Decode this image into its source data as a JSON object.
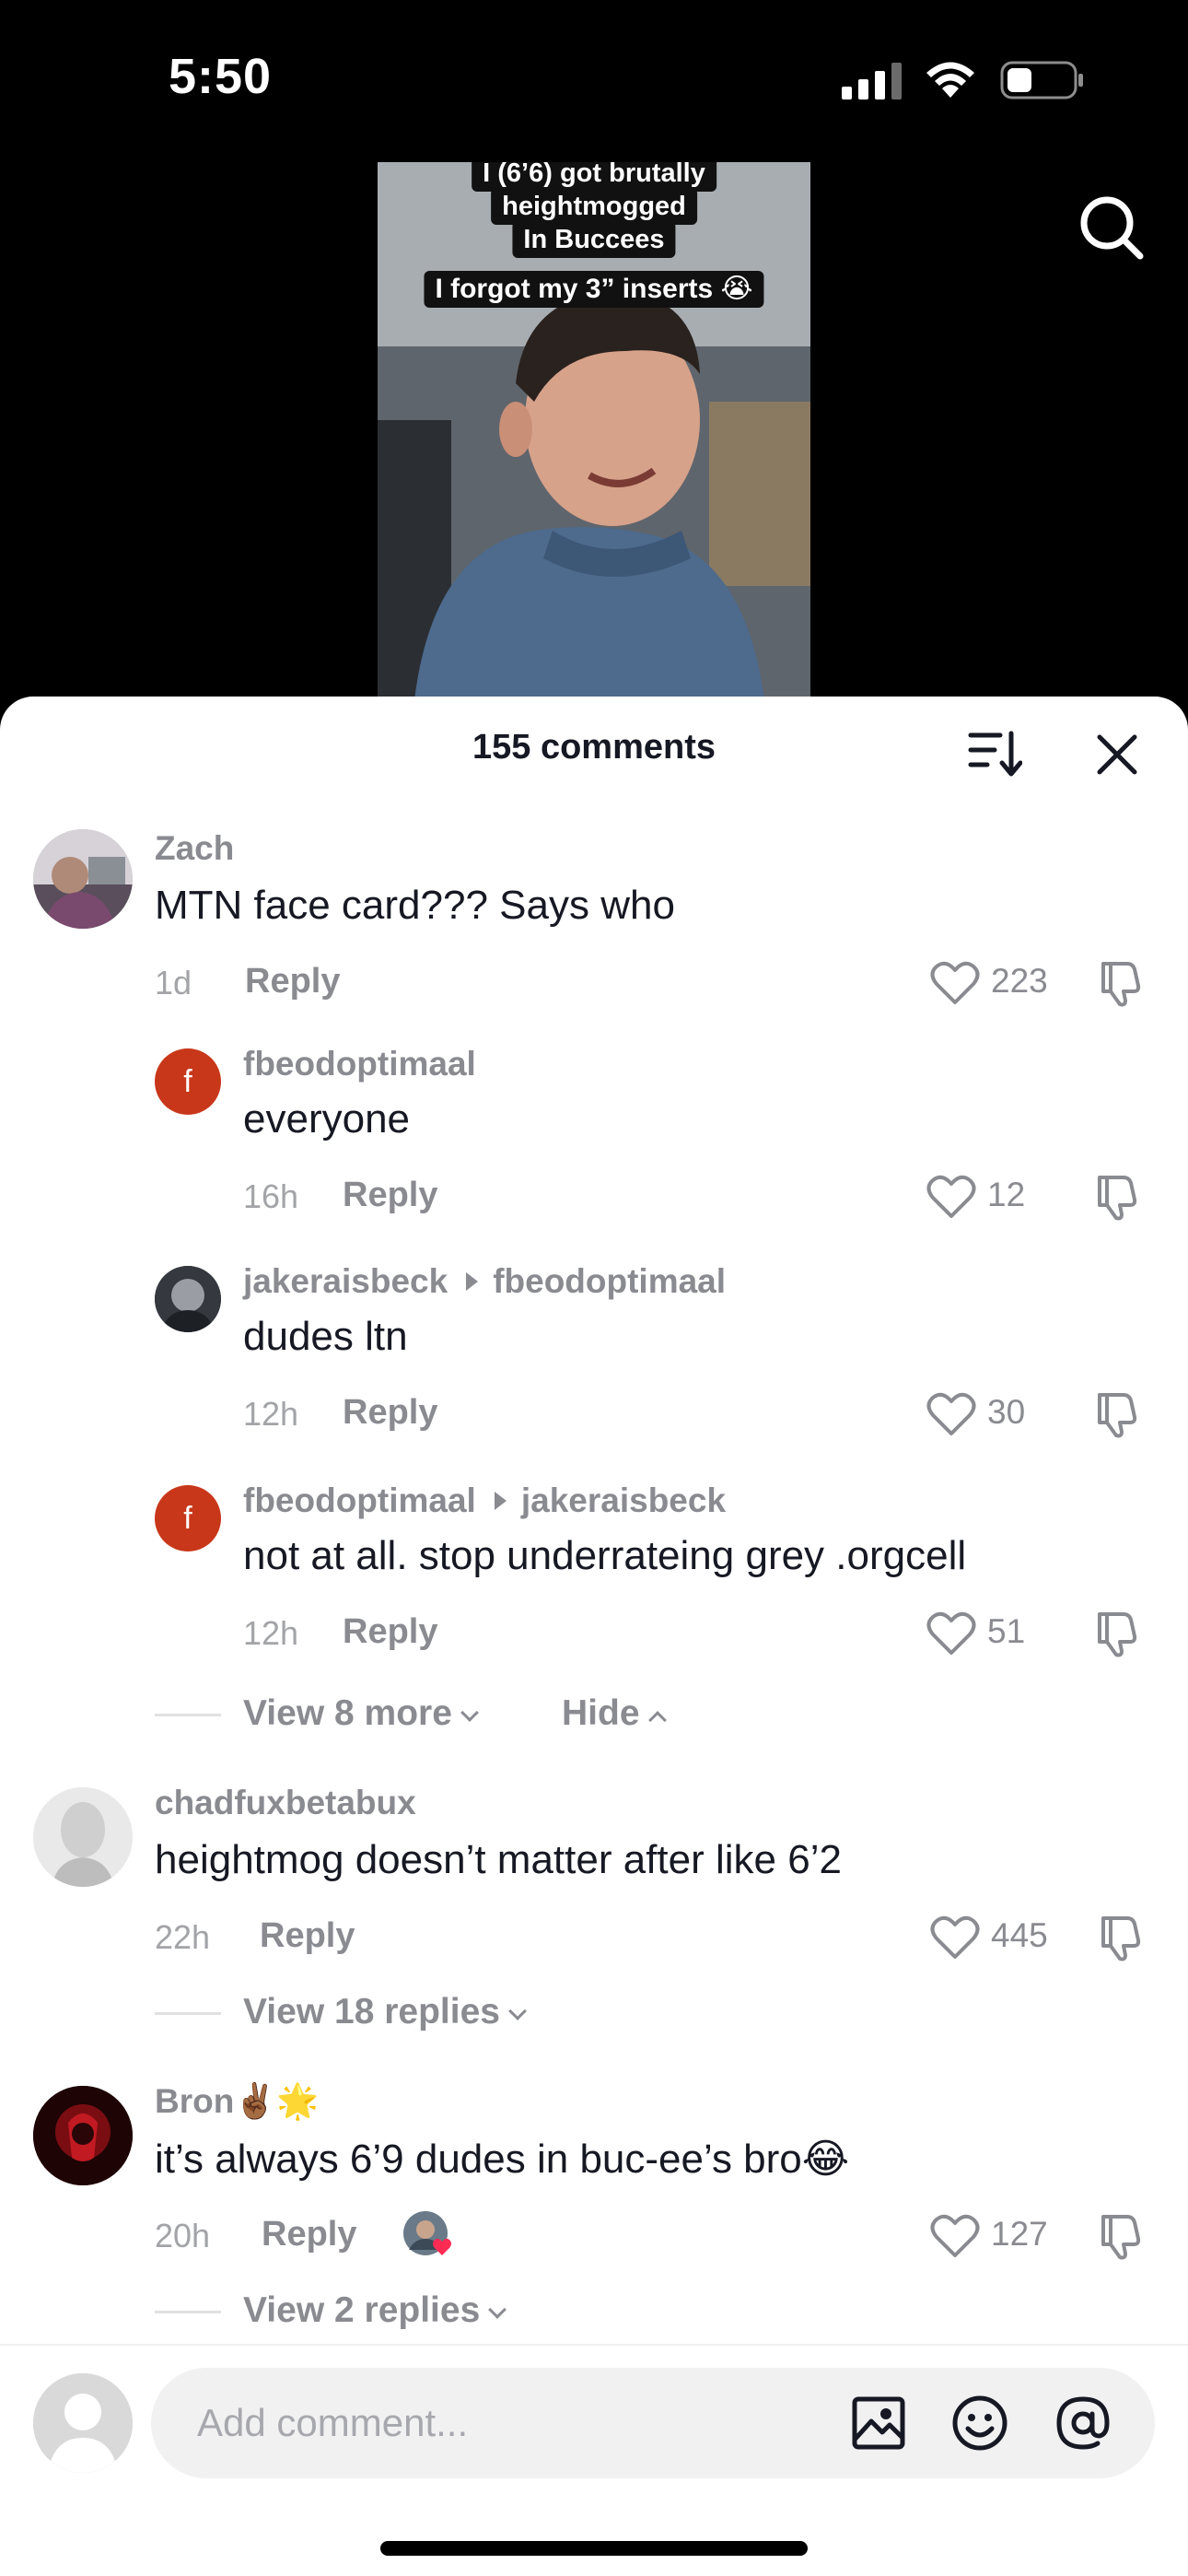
{
  "status_bar": {
    "time": "5:50"
  },
  "video": {
    "caption_lines": [
      "I (6’6) got brutally",
      "heightmogged",
      "In Buccees"
    ],
    "caption_2": "I forgot my 3” inserts 😭"
  },
  "sheet": {
    "title": "155 comments",
    "comments": [
      {
        "user": "Zach",
        "text": "MTN face card??? Says who",
        "time": "1d",
        "reply": "Reply",
        "likes": "223"
      },
      {
        "user": "fbeodoptimaal",
        "avatar_letter": "f",
        "text": "everyone",
        "time": "16h",
        "reply": "Reply",
        "likes": "12"
      },
      {
        "user": "jakeraisbeck",
        "reply_to": "fbeodoptimaal",
        "text": "dudes ltn",
        "time": "12h",
        "reply": "Reply",
        "likes": "30"
      },
      {
        "user": "fbeodoptimaal",
        "avatar_letter": "f",
        "reply_to": "jakeraisbeck",
        "text": "not at all. stop underrateing grey .orgcell",
        "time": "12h",
        "reply": "Reply",
        "likes": "51"
      },
      {
        "user": "chadfuxbetabux",
        "text": "heightmog doesn’t matter after like 6’2",
        "time": "22h",
        "reply": "Reply",
        "likes": "445"
      },
      {
        "user": "Bron✌🏾🌟",
        "text": "it’s always 6’9 dudes in buc-ee’s bro😂",
        "time": "20h",
        "reply": "Reply",
        "likes": "127"
      }
    ],
    "view_more_1": "View 8 more",
    "hide": "Hide",
    "view_replies_2": "View 18 replies",
    "view_replies_3": "View 2 replies"
  },
  "input": {
    "placeholder": "Add comment..."
  }
}
